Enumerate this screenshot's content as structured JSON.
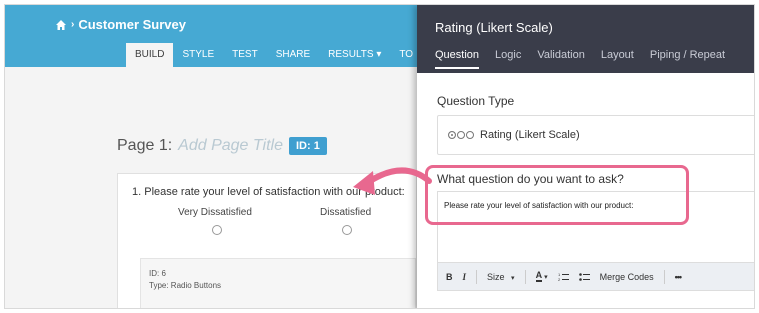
{
  "builder": {
    "survey_title": "Customer Survey",
    "tabs": [
      "BUILD",
      "STYLE",
      "TEST",
      "SHARE",
      "RESULTS ▾",
      "TO"
    ],
    "page_label": "Page 1:",
    "page_title_placeholder": "Add Page Title",
    "page_id_badge": "ID: 1",
    "question": {
      "text": "1. Please rate your level of satisfaction with our product:",
      "scale_labels": [
        "Very Dissatisfied",
        "Dissatisfied"
      ],
      "meta_id": "ID: 6",
      "meta_type": "Type: Radio Buttons"
    }
  },
  "panel": {
    "title": "Rating (Likert Scale)",
    "tabs": [
      "Question",
      "Logic",
      "Validation",
      "Layout",
      "Piping / Repeat"
    ],
    "question_type_label": "Question Type",
    "question_type_value": "Rating (Likert Scale)",
    "question_prompt_label": "What question do you want to ask?",
    "question_text_value": "Please rate your level of satisfaction with our product:",
    "toolbar": {
      "bold": "B",
      "italic": "I",
      "size": "Size",
      "size_caret": "▾",
      "font_color": "A",
      "merge_codes": "Merge Codes",
      "more": "•••"
    }
  },
  "colors": {
    "topbar": "#46a9d3",
    "panel_header": "#3a3d4a",
    "highlight": "#e8688f",
    "id_badge": "#3f9fd0"
  }
}
